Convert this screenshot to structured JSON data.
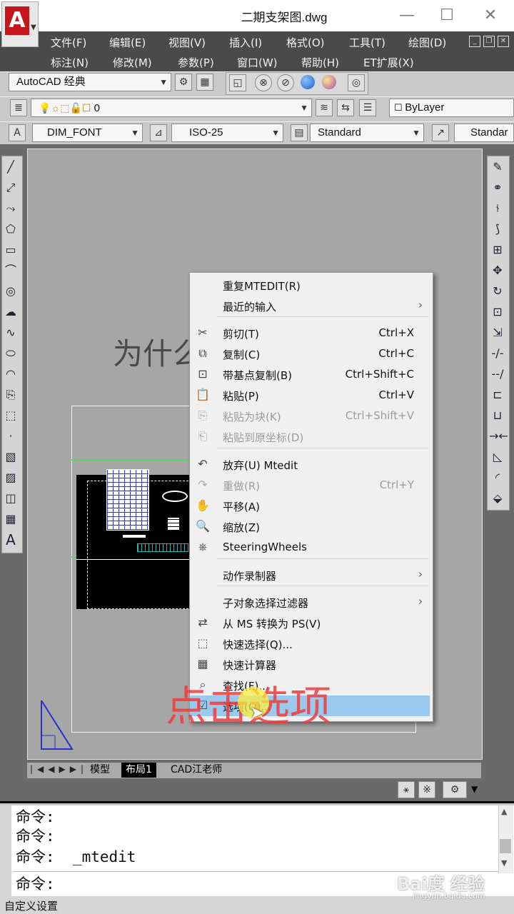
{
  "window": {
    "title": "二期支架图.dwg",
    "minimize": "—",
    "maximize": "☐",
    "close": "✕"
  },
  "menubar": {
    "row1": [
      "文件(F)",
      "编辑(E)",
      "视图(V)",
      "插入(I)",
      "格式(O)",
      "工具(T)",
      "绘图(D)"
    ],
    "row2": [
      "标注(N)",
      "修改(M)",
      "参数(P)",
      "窗口(W)",
      "帮助(H)",
      "ET扩展(X)"
    ]
  },
  "toolbar": {
    "workspace": "AutoCAD 经典",
    "layer_value": "0",
    "bylayer": "ByLayer",
    "text_style": "DIM_FONT",
    "dim_style": "ISO-25",
    "table_style": "Standard",
    "multileader_style": "Standar"
  },
  "canvas": {
    "watermark_text": "为什么指",
    "overlay_caption": "点击选项"
  },
  "context_menu": {
    "items": [
      {
        "label": "重复MTEDIT(R)",
        "shortcut": "",
        "submenu": false,
        "disabled": false,
        "icon": ""
      },
      {
        "label": "最近的输入",
        "shortcut": "",
        "submenu": true,
        "disabled": false,
        "icon": ""
      },
      {
        "label": "剪切(T)",
        "shortcut": "Ctrl+X",
        "submenu": false,
        "disabled": false,
        "icon": "scissors-icon"
      },
      {
        "label": "复制(C)",
        "shortcut": "Ctrl+C",
        "submenu": false,
        "disabled": false,
        "icon": "copy-icon"
      },
      {
        "label": "带基点复制(B)",
        "shortcut": "Ctrl+Shift+C",
        "submenu": false,
        "disabled": false,
        "icon": "copy-base-icon"
      },
      {
        "label": "粘贴(P)",
        "shortcut": "Ctrl+V",
        "submenu": false,
        "disabled": false,
        "icon": "paste-icon"
      },
      {
        "label": "粘贴为块(K)",
        "shortcut": "Ctrl+Shift+V",
        "submenu": false,
        "disabled": true,
        "icon": "paste-block-icon"
      },
      {
        "label": "粘贴到原坐标(D)",
        "shortcut": "",
        "submenu": false,
        "disabled": true,
        "icon": "paste-orig-icon"
      },
      {
        "label": "放弃(U) Mtedit",
        "shortcut": "",
        "submenu": false,
        "disabled": false,
        "icon": "undo-icon"
      },
      {
        "label": "重做(R)",
        "shortcut": "Ctrl+Y",
        "submenu": false,
        "disabled": true,
        "icon": "redo-icon"
      },
      {
        "label": "平移(A)",
        "shortcut": "",
        "submenu": false,
        "disabled": false,
        "icon": "pan-icon"
      },
      {
        "label": "缩放(Z)",
        "shortcut": "",
        "submenu": false,
        "disabled": false,
        "icon": "zoom-icon"
      },
      {
        "label": "SteeringWheels",
        "shortcut": "",
        "submenu": false,
        "disabled": false,
        "icon": "steering-wheel-icon"
      },
      {
        "label": "动作录制器",
        "shortcut": "",
        "submenu": true,
        "disabled": false,
        "icon": ""
      },
      {
        "label": "子对象选择过滤器",
        "shortcut": "",
        "submenu": true,
        "disabled": false,
        "icon": ""
      },
      {
        "label": "从 MS 转换为 PS(V)",
        "shortcut": "",
        "submenu": false,
        "disabled": false,
        "icon": "convert-space-icon"
      },
      {
        "label": "快速选择(Q)...",
        "shortcut": "",
        "submenu": false,
        "disabled": false,
        "icon": "quick-select-icon"
      },
      {
        "label": "快速计算器",
        "shortcut": "",
        "submenu": false,
        "disabled": false,
        "icon": "calculator-icon"
      },
      {
        "label": "查找(F)...",
        "shortcut": "",
        "submenu": false,
        "disabled": false,
        "icon": "find-icon"
      },
      {
        "label": "选项(O)...",
        "shortcut": "",
        "submenu": false,
        "disabled": false,
        "icon": "options-icon",
        "highlighted": true
      }
    ]
  },
  "tabs": [
    "模型",
    "布局1",
    "CAD江老师"
  ],
  "command": {
    "history": [
      "命令:",
      "命令:",
      "命令:  _mtedit"
    ],
    "prompt": "命令:"
  },
  "statusbar": {
    "text": "自定义设置"
  },
  "watermark": {
    "brand": "Bai度 经验",
    "url": "jingyan.baidu.com"
  },
  "colors": {
    "menubar_bg": "#4a4a4a",
    "toolbar_bg": "#c9c9c9",
    "workarea_bg": "#6a6a6a",
    "highlight": "#99c9ef",
    "caption_red": "#f03c3c"
  }
}
